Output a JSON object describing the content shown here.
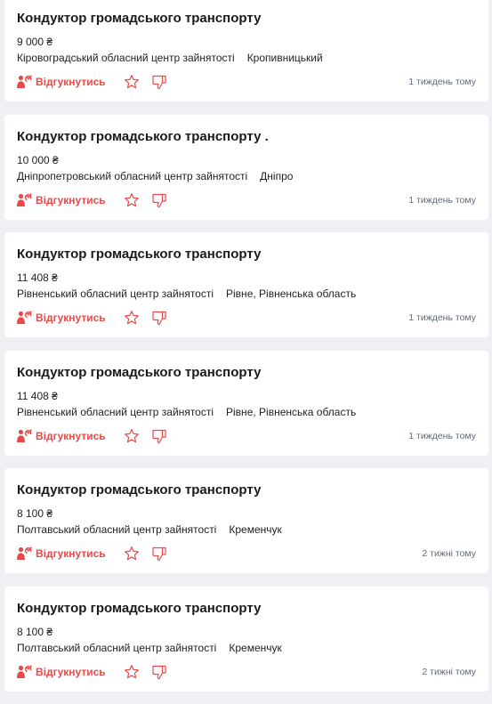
{
  "actions": {
    "respond_label": "Відгукнутись"
  },
  "colors": {
    "accent": "#e84a4a",
    "background": "#eef0f3",
    "card": "#ffffff"
  },
  "icons": {
    "respond": "person-respond-icon",
    "favorite": "star-icon",
    "dislike": "thumbs-down-icon"
  },
  "jobs": [
    {
      "title": "Кондуктор громадського транспорту",
      "salary": "9 000 ₴",
      "employer": "Кіровоградський обласний центр зайнятості",
      "city": "Кропивницький",
      "posted": "1 тиждень тому"
    },
    {
      "title": "Кондуктор громадського транспорту .",
      "salary": "10 000 ₴",
      "employer": "Дніпропетровський обласний центр зайнятості",
      "city": "Дніпро",
      "posted": "1 тиждень тому"
    },
    {
      "title": "Кондуктор громадського транспорту",
      "salary": "11 408 ₴",
      "employer": "Рівненський обласний центр зайнятості",
      "city": "Рівне, Рівненська область",
      "posted": "1 тиждень тому"
    },
    {
      "title": "Кондуктор громадського транспорту",
      "salary": "11 408 ₴",
      "employer": "Рівненський обласний центр зайнятості",
      "city": "Рівне, Рівненська область",
      "posted": "1 тиждень тому"
    },
    {
      "title": "Кондуктор громадського транспорту",
      "salary": "8 100 ₴",
      "employer": "Полтавський обласний центр зайнятості",
      "city": "Кременчук",
      "posted": "2 тижні тому"
    },
    {
      "title": "Кондуктор громадського транспорту",
      "salary": "8 100 ₴",
      "employer": "Полтавський обласний центр зайнятості",
      "city": "Кременчук",
      "posted": "2 тижні тому"
    }
  ]
}
